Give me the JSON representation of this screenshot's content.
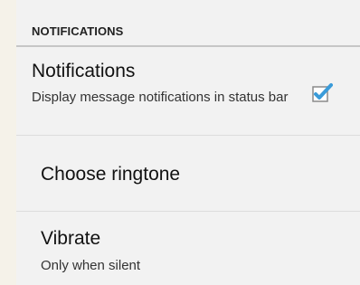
{
  "section": {
    "header": "NOTIFICATIONS"
  },
  "notifications": {
    "title": "Notifications",
    "summary": "Display message notifications in status bar",
    "checked": true,
    "check_color": "#3a9bd9"
  },
  "ringtone": {
    "title": "Choose ringtone"
  },
  "vibrate": {
    "title": "Vibrate",
    "summary": "Only when silent"
  }
}
